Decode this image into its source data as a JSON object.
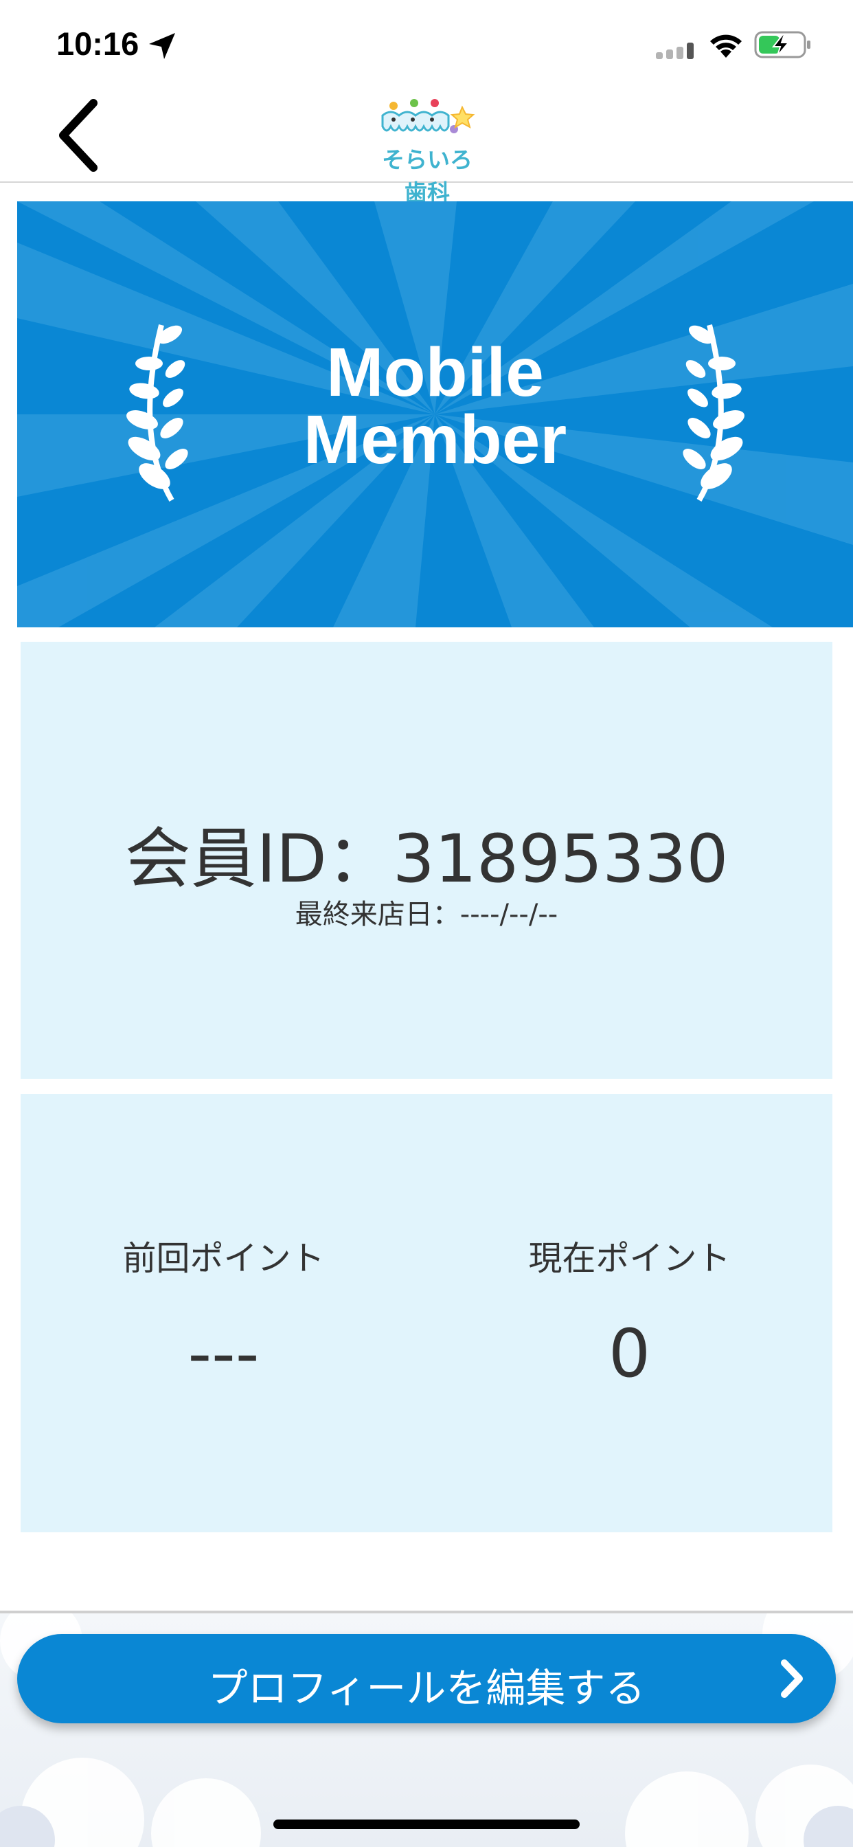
{
  "status_bar": {
    "time": "10:16",
    "icons": [
      "location-arrow-icon",
      "signal-icon",
      "wifi-icon",
      "battery-charging-icon"
    ]
  },
  "nav": {
    "back_icon": "chevron-left-icon",
    "logo_text": "そらいろ歯科"
  },
  "banner": {
    "title_line1": "Mobile",
    "title_line2": "Member",
    "color": "#0a87d4"
  },
  "member_card": {
    "member_id": "会員ID：31895330",
    "last_visit": "最終来店日：----/--/--",
    "background": "#e1f4fc"
  },
  "points_card": {
    "previous_label": "前回ポイント",
    "previous_value": "---",
    "current_label": "現在ポイント",
    "current_value": "0"
  },
  "edit_profile": {
    "label": "プロフィールを編集する",
    "icon": "chevron-right-icon",
    "color": "#0a87d4"
  }
}
